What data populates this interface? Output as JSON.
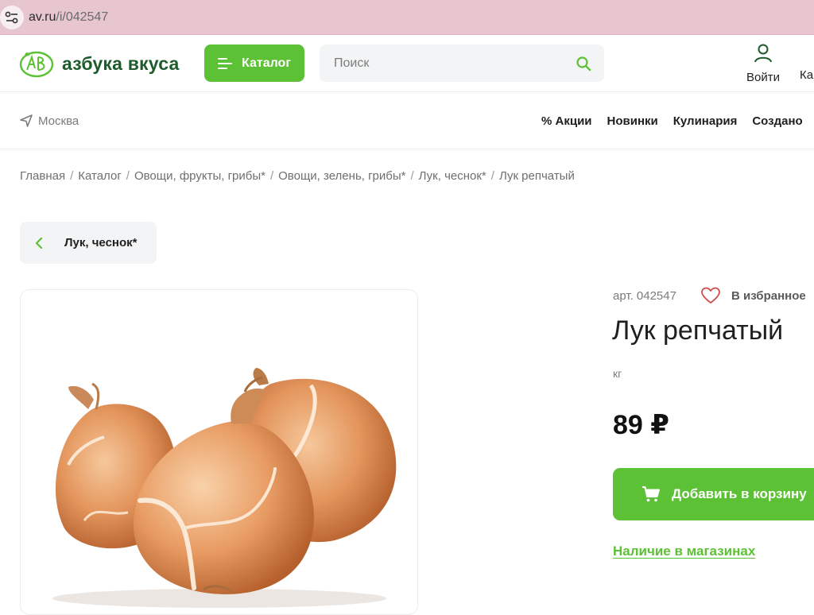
{
  "browser": {
    "url_host": "av.ru",
    "url_path": "/i/042547"
  },
  "header": {
    "logo_text": "азбука вкуса",
    "catalog_label": "Каталог",
    "search_placeholder": "Поиск",
    "login_label": "Войти",
    "cart_label": "Ка"
  },
  "nav": {
    "city": "Москва",
    "links": [
      "% Акции",
      "Новинки",
      "Кулинария",
      "Создано"
    ]
  },
  "breadcrumb": [
    "Главная",
    "Каталог",
    "Овощи, фрукты, грибы*",
    "Овощи, зелень, грибы*",
    "Лук, чеснок*",
    "Лук репчатый"
  ],
  "back": {
    "label": "Лук, чеснок*"
  },
  "product": {
    "sku": "арт. 042547",
    "favorite_label": "В избранное",
    "title": "Лук репчатый",
    "unit": "кг",
    "price": "89 ₽",
    "add_to_cart_label": "Добавить в корзину",
    "availability_link": "Наличие в магазинах"
  },
  "colors": {
    "brand_green": "#5cc135",
    "logo_green": "#1e5b2c",
    "address_bar": "#e7c6d0"
  }
}
